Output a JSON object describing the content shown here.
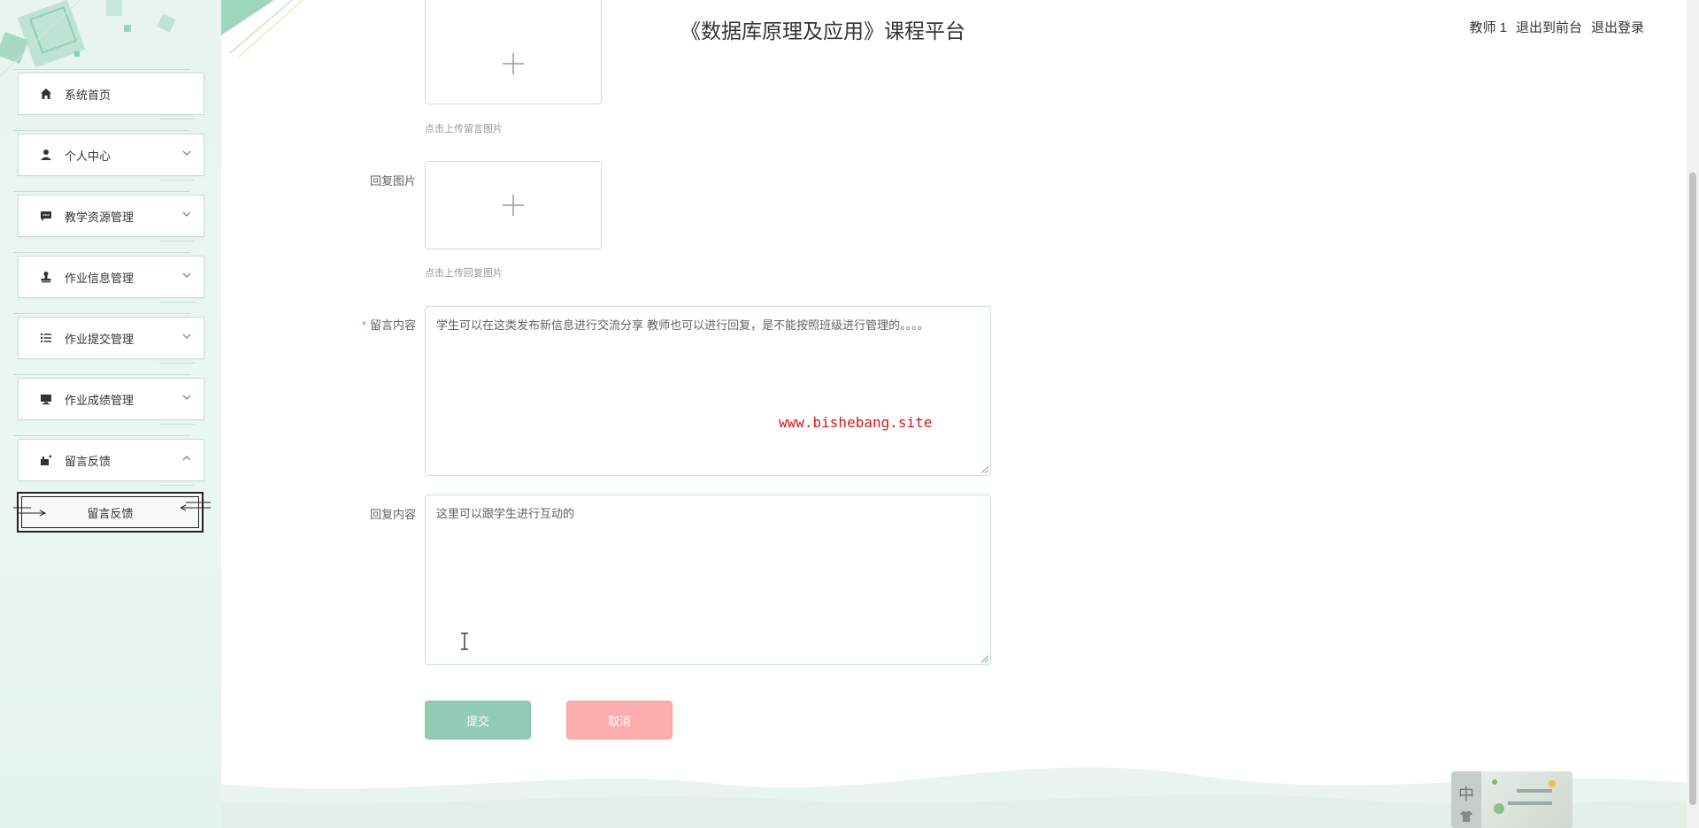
{
  "header": {
    "title": "《数据库原理及应用》课程平台",
    "user": "教师 1",
    "links": [
      "退出到前台",
      "退出登录"
    ]
  },
  "sidebar": {
    "items": [
      {
        "label": "系统首页",
        "icon": "home-icon"
      },
      {
        "label": "个人中心",
        "icon": "user-icon"
      },
      {
        "label": "教学资源管理",
        "icon": "chat-icon"
      },
      {
        "label": "作业信息管理",
        "icon": "stamp-icon"
      },
      {
        "label": "作业提交管理",
        "icon": "list-icon"
      },
      {
        "label": "作业成绩管理",
        "icon": "monitor-icon"
      },
      {
        "label": "留言反馈",
        "icon": "feedback-icon"
      }
    ],
    "submenu": {
      "label": "留言反馈"
    }
  },
  "form": {
    "message_image_tip": "点击上传留言图片",
    "reply_image_label": "回复图片",
    "reply_image_tip": "点击上传回复图片",
    "message_content_label": "留言内容",
    "message_content_value": "学生可以在这类发布新信息进行交流分享 教师也可以进行回复，是不能按照班级进行管理的。。。。",
    "watermark": "www.bishebang.site",
    "reply_content_label": "回复内容",
    "reply_content_value": "这里可以跟学生进行互动的",
    "submit_label": "提交",
    "cancel_label": "取消"
  },
  "widget": {
    "zh": "中"
  },
  "colors": {
    "accent": "#3aa176",
    "danger": "#fb6b6b",
    "sidebar_bg": "#e8f5ef"
  }
}
